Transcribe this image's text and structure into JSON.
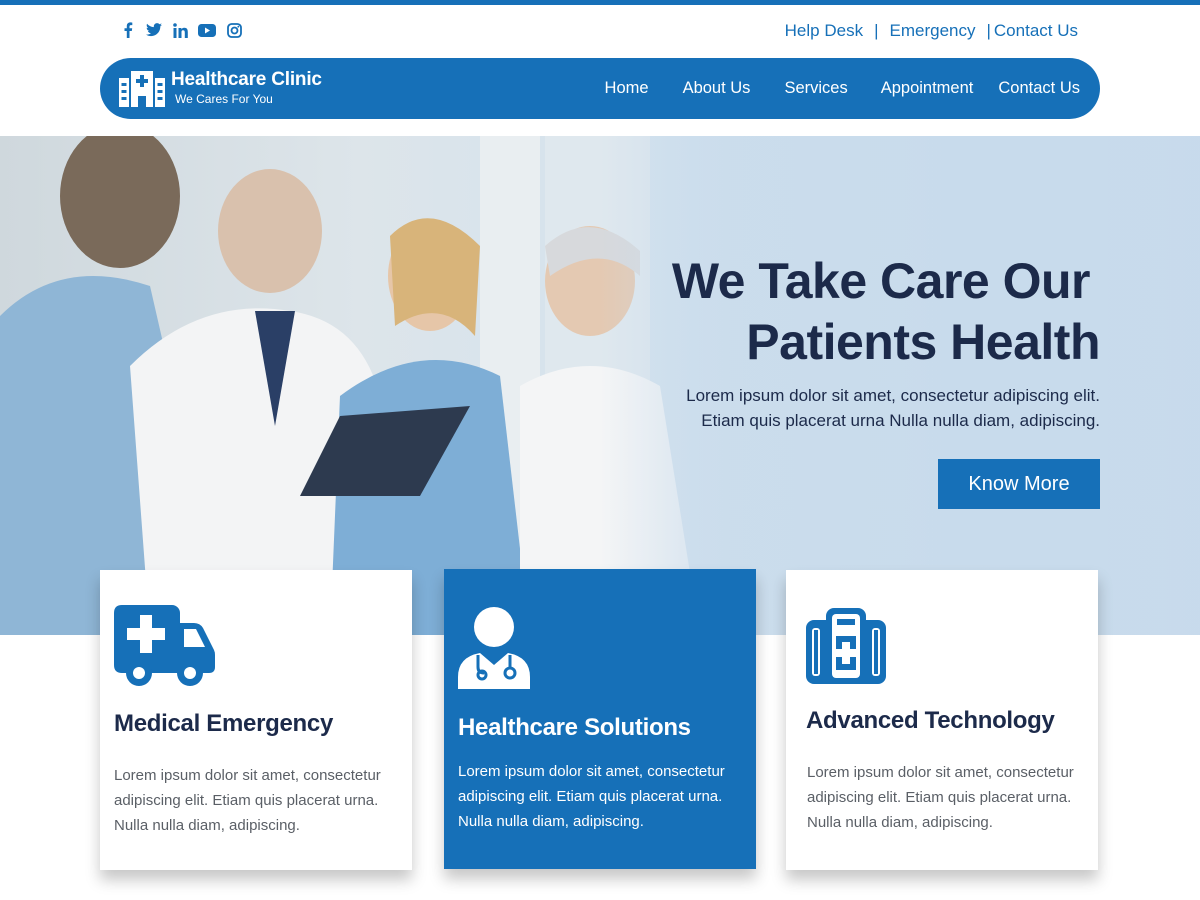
{
  "colors": {
    "brand": "#1670b8",
    "heading": "#1c2a4a",
    "body_text": "#5a5f66"
  },
  "social_icons": [
    "facebook-icon",
    "twitter-icon",
    "linkedin-icon",
    "youtube-icon",
    "instagram-icon"
  ],
  "top_links": {
    "help": "Help Desk",
    "emergency": "Emergency",
    "contact": "Contact Us",
    "separator": "|"
  },
  "logo": {
    "title": "Healthcare Clinic",
    "tagline": "We Cares For You"
  },
  "nav": {
    "home": "Home",
    "about": "About Us",
    "services": "Services",
    "appointment": "Appointment",
    "contact": "Contact Us"
  },
  "hero": {
    "title_line1": "We Take Care Our",
    "title_line2": "Patients Health",
    "sub_line1": "Lorem ipsum dolor sit amet, consectetur adipiscing elit.",
    "sub_line2": "Etiam quis placerat urna Nulla nulla diam, adipiscing.",
    "button": "Know More"
  },
  "cards": [
    {
      "icon": "ambulance-icon",
      "title": "Medical Emergency",
      "text": "Lorem ipsum dolor sit amet, consectetur adipiscing elit. Etiam quis placerat urna. Nulla nulla diam, adipiscing."
    },
    {
      "icon": "doctor-icon",
      "title": "Healthcare Solutions",
      "text": "Lorem ipsum dolor sit amet, consectetur adipiscing elit. Etiam quis placerat urna. Nulla nulla diam, adipiscing."
    },
    {
      "icon": "medical-kit-icon",
      "title": "Advanced Technology",
      "text": "Lorem ipsum dolor sit amet, consectetur adipiscing elit. Etiam quis placerat urna. Nulla nulla diam, adipiscing."
    }
  ]
}
